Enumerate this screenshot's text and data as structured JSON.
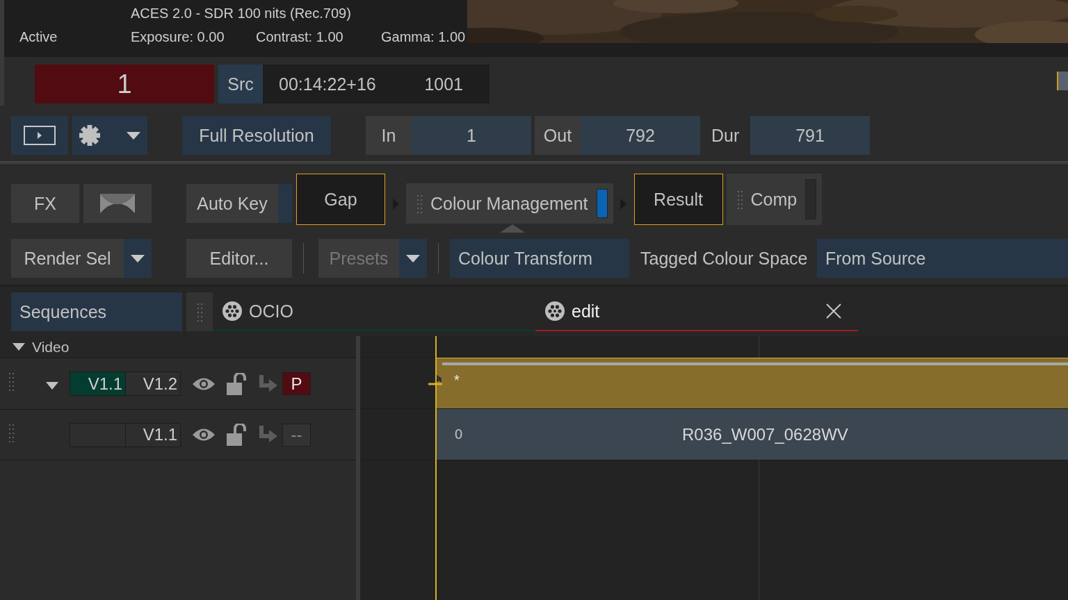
{
  "viewer_info": {
    "status": "Active",
    "display": "ACES 2.0 - SDR 100 nits (Rec.709)",
    "exposure": "Exposure: 0.00",
    "contrast": "Contrast: 1.00",
    "gamma": "Gamma: 1.00"
  },
  "transport": {
    "frame": "1",
    "source_label": "Src",
    "timecode": "00:14:22+16",
    "source_frame": "1001"
  },
  "playback_bar": {
    "resolution": "Full Resolution",
    "in_label": "In",
    "in_value": "1",
    "out_label": "Out",
    "out_value": "792",
    "dur_label": "Dur",
    "dur_value": "791"
  },
  "node_graph": {
    "nodes": [
      {
        "kind": "button",
        "label": "FX"
      },
      {
        "kind": "wipe"
      },
      {
        "kind": "key",
        "label": "Auto Key"
      },
      {
        "kind": "node",
        "label": "Gap",
        "selected": true
      },
      {
        "kind": "arrow"
      },
      {
        "kind": "layer",
        "label": "Colour Management",
        "selected": false,
        "enabled": true,
        "current": true
      },
      {
        "kind": "arrow"
      },
      {
        "kind": "node",
        "label": "Result",
        "selected": true
      },
      {
        "kind": "layer",
        "label": "Comp",
        "selected": false,
        "enabled": false,
        "current": false
      }
    ]
  },
  "render_toolbar": {
    "render_button": "Render Sel",
    "editor_button": "Editor...",
    "presets": {
      "label": "Presets",
      "disabled": true
    },
    "transform": "Colour Transform",
    "tagged_label": "Tagged Colour Space",
    "tagged_value": "From Source"
  },
  "sequences_button": "Sequences",
  "tabs": [
    {
      "label": "OCIO",
      "selected": false,
      "color": "#0b3a2e",
      "closable": false
    },
    {
      "label": "edit",
      "selected": true,
      "color": "#a01c24",
      "closable": true
    }
  ],
  "track_group": {
    "label": "Video",
    "expanded": true
  },
  "tracks": [
    {
      "expanded": true,
      "versions": [
        {
          "label": "V1.1",
          "selected": true
        },
        {
          "label": "V1.2",
          "selected": false
        }
      ],
      "visible": true,
      "locked": false,
      "badge": {
        "text": "P",
        "active": true
      }
    },
    {
      "expanded": false,
      "versions": [
        {
          "label": "V1.1",
          "selected": false
        }
      ],
      "visible": true,
      "locked": false,
      "badge": {
        "text": "--",
        "active": false
      }
    }
  ],
  "timeline_clips": [
    {
      "kind": "gap",
      "label": "*"
    },
    {
      "kind": "clip",
      "start_frame": "0",
      "name": "R036_W007_0628WV"
    }
  ]
}
